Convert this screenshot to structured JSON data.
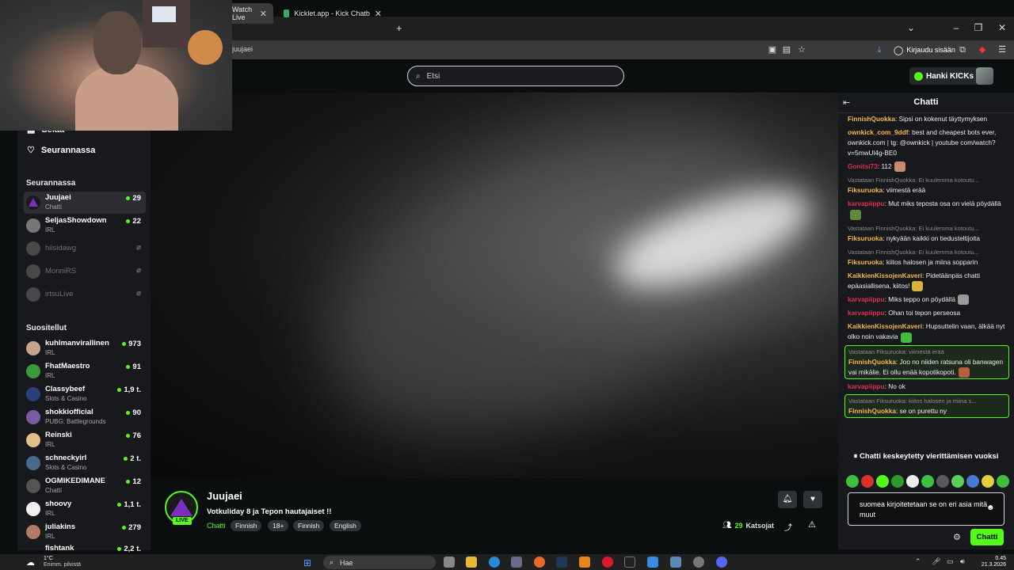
{
  "browser": {
    "tabs": [
      {
        "label": "Watch Live",
        "active": true
      },
      {
        "label": "Kicklet.app - Kick Chatbot and C",
        "active": false
      }
    ],
    "new_tab_icon": "plus-icon",
    "address": "juujaei",
    "signin_label": "Kirjaudu sisään"
  },
  "site": {
    "search_placeholder": "Etsi",
    "kicks_label": "Hanki KICKs",
    "accent": "#53fc18"
  },
  "sidebar": {
    "nav": [
      {
        "label": "Selaa",
        "icon": "browse-icon"
      },
      {
        "label": "Seurannassa",
        "icon": "heart-icon"
      }
    ],
    "following_title": "Seurannassa",
    "following": [
      {
        "name": "Juujaei",
        "category": "Chatti",
        "viewers": "29",
        "live": true,
        "active": true
      },
      {
        "name": "SeljasShowdown",
        "category": "IRL",
        "viewers": "22",
        "live": true
      },
      {
        "name": "hiisidawg",
        "category": "",
        "viewers": "",
        "live": false
      },
      {
        "name": "MonniRS",
        "category": "",
        "viewers": "",
        "live": false
      },
      {
        "name": "irtsuLive",
        "category": "",
        "viewers": "",
        "live": false
      }
    ],
    "recommended_title": "Suositellut",
    "recommended": [
      {
        "name": "kuhlmanvirallinen",
        "category": "IRL",
        "viewers": "973"
      },
      {
        "name": "FhatMaestro",
        "category": "IRL",
        "viewers": "91"
      },
      {
        "name": "Classybeef",
        "category": "Slots & Casino",
        "viewers": "1,9 t."
      },
      {
        "name": "shokkiofficial",
        "category": "PUBG: Battlegrounds",
        "viewers": "90"
      },
      {
        "name": "Reinski",
        "category": "IRL",
        "viewers": "76"
      },
      {
        "name": "schneckyirl",
        "category": "Slots & Casino",
        "viewers": "2 t."
      },
      {
        "name": "OGMIKEDIMANE",
        "category": "Chatti",
        "viewers": "12"
      },
      {
        "name": "shoovy",
        "category": "IRL",
        "viewers": "1,1 t."
      },
      {
        "name": "juliakins",
        "category": "IRL",
        "viewers": "279"
      },
      {
        "name": "fishtank",
        "category": "",
        "viewers": "2,2 t."
      }
    ]
  },
  "stream": {
    "name": "Juujaei",
    "live_badge": "LIVE",
    "title": "Votkuliday 8 ja Tepon hautajaiset !!",
    "category": "Chatti",
    "tags": [
      "Finnish",
      "18+",
      "Finnish",
      "English"
    ],
    "viewers": "29",
    "viewers_label": "Katsojat"
  },
  "chat": {
    "title": "Chatti",
    "messages": [
      {
        "user": "FinnishQuokka",
        "color": "#f2b84b",
        "text": "Sipsi on kokenut täyttymyksen",
        "reply": ""
      },
      {
        "user": "ownkick_com_9ddf",
        "color": "#f2b84b",
        "text": "best and cheapest bots ever, ownkick.com | tg: @ownkick | youtube com/watch?v=5mwUl4g-BE0",
        "reply": ""
      },
      {
        "user": "Gonitsi73",
        "color": "#e0304e",
        "text": "112",
        "reply": "",
        "emote": "#c98b6a"
      },
      {
        "user": "Fiksuruoka",
        "color": "#f2b84b",
        "text": "viimestä erää",
        "reply": "Vastataan FinnishQuokka: Ei kuulemma kotoutu..."
      },
      {
        "user": "karvapiippu",
        "color": "#e0304e",
        "text": "Mut miks teposta osa on vielä pöydällä",
        "reply": "",
        "emote": "#5c8a3a"
      },
      {
        "user": "Fiksuruoka",
        "color": "#f2b84b",
        "text": "nykyään kaikki on tiedusteltijoita",
        "reply": "Vastataan FinnishQuokka: Ei kuulemma kotoutu..."
      },
      {
        "user": "Fiksuruoka",
        "color": "#f2b84b",
        "text": "kiitos halosen ja miina sopparin",
        "reply": "Vastataan FinnishQuokka: Ei kuulemma kotoutu..."
      },
      {
        "user": "KaikkienKissojenKaveri",
        "color": "#f2b84b",
        "text": "Pidetäänpäs chatti epäasiallisena, kiitos!",
        "reply": "",
        "emote": "#d9b23a"
      },
      {
        "user": "karvapiippu",
        "color": "#e0304e",
        "text": "Miks teppo on pöydällä",
        "reply": "",
        "emote": "#9a9a9a"
      },
      {
        "user": "karvapiippu",
        "color": "#e0304e",
        "text": "Ohan toi tepon perseosa",
        "reply": ""
      },
      {
        "user": "KaikkienKissojenKaveri",
        "color": "#f2b84b",
        "text": "Hupsuttelin vaan, älkää nyt olko noin vakavia",
        "reply": "",
        "emote": "#3fbf3f"
      },
      {
        "user": "FinnishQuokka",
        "color": "#f2b84b",
        "text": "Joo no niiden ratsuna oli banwagen vai mikälie. Ei ollu enää kopotikopoti.",
        "reply": "Vastataan Fiksuruoka: viimestä erää",
        "highlight": true,
        "emote": "#b5603a"
      },
      {
        "user": "karvapiippu",
        "color": "#e0304e",
        "text": "No ok",
        "reply": ""
      },
      {
        "user": "FinnishQuokka",
        "color": "#f2b84b",
        "text": "se on purettu ny",
        "reply": "Vastataan Fiksuruoka: kiitos halosen ja miina s...",
        "highlight": true
      }
    ],
    "paused_label": "Chatti keskeytetty vierittämisen vuoksi",
    "input_value": "suomea kirjoitetetaan se on eri asia mitä muut",
    "send_label": "Chatti"
  },
  "taskbar": {
    "weather_temp": "1°C",
    "weather_desc": "Enimm. pilvistä",
    "search_label": "Hae",
    "time": "0.45",
    "date": "21.3.2026"
  }
}
